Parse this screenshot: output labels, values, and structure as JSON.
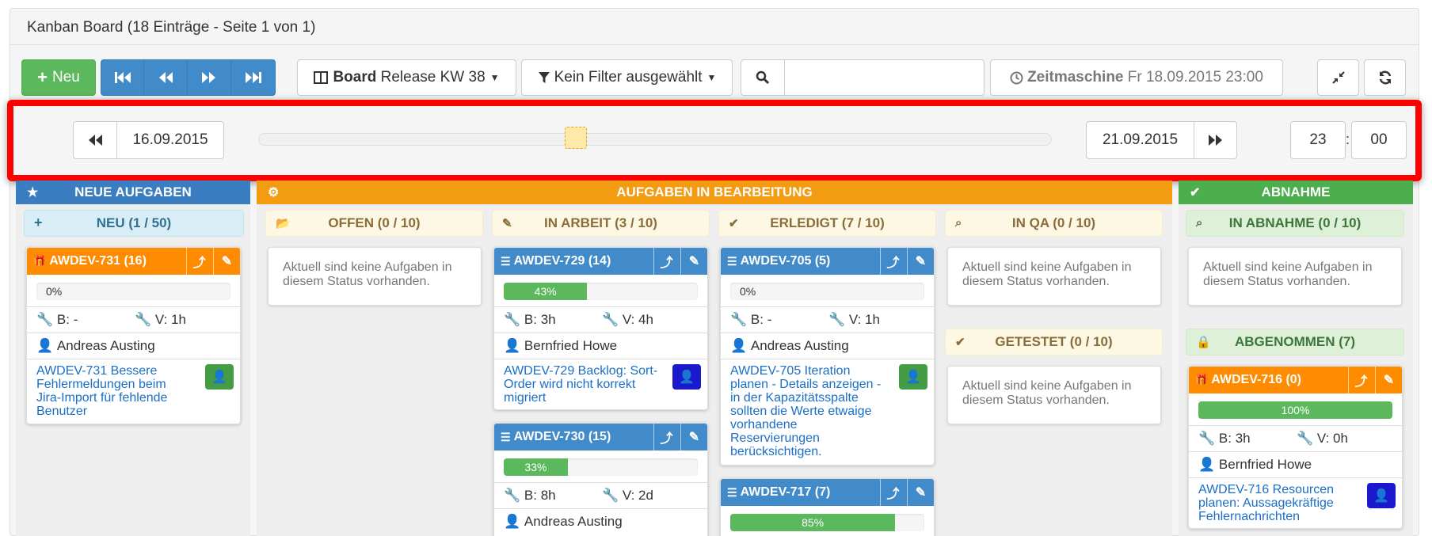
{
  "title": "Kanban Board (18 Einträge - Seite 1 von 1)",
  "toolbar": {
    "new_label": "Neu",
    "board_bold": "Board",
    "board_value": "Release KW 38",
    "filter_label": "Kein Filter ausgewählt",
    "search_value": "",
    "timemachine_bold": "Zeitmaschine",
    "timemachine_value": "Fr 18.09.2015 23:00"
  },
  "timeline": {
    "start_date": "16.09.2015",
    "end_date": "21.09.2015",
    "hour": "23",
    "minute": "00",
    "separator": ":",
    "slider_position": 0.4
  },
  "columns": {
    "neue": {
      "label": "NEUE AUFGABEN",
      "color": "#3a7dc1"
    },
    "bearbeitung": {
      "label": "AUFGABEN IN BEARBEITUNG",
      "color": "#f39c12"
    },
    "abnahme": {
      "label": "ABNAHME",
      "color": "#4cae4c"
    }
  },
  "sublanes": {
    "neu": "NEU (1 / 50)",
    "offen": "OFFEN (0 / 10)",
    "inarbeit": "IN ARBEIT (3 / 10)",
    "erledigt": "ERLEDIGT (7 / 10)",
    "inqa": "IN QA (0 / 10)",
    "getestet": "GETESTET (0 / 10)",
    "inabnahme": "IN ABNAHME (0 / 10)",
    "abgenommen": "ABGENOMMEN (7)"
  },
  "empty_text": "Aktuell sind keine Aufgaben in diesem Status vorhanden.",
  "cards": {
    "c731": {
      "id": "AWDEV-731 (16)",
      "progress_label": "0%",
      "progress": 0,
      "b": "B: -",
      "v": "V: 1h",
      "person": "Andreas Austing",
      "desc": "AWDEV-731 Bessere Fehlermeldungen beim Jira-Import für fehlende Benutzer"
    },
    "c729": {
      "id": "AWDEV-729 (14)",
      "progress_label": "43%",
      "progress": 43,
      "b": "B: 3h",
      "v": "V: 4h",
      "person": "Bernfried Howe",
      "desc": "AWDEV-729 Backlog: Sort-Order wird nicht korrekt migriert"
    },
    "c730": {
      "id": "AWDEV-730 (15)",
      "progress_label": "33%",
      "progress": 33,
      "b": "B: 8h",
      "v": "V: 2d",
      "person": "Andreas Austing"
    },
    "c705": {
      "id": "AWDEV-705 (5)",
      "progress_label": "0%",
      "progress": 0,
      "b": "B: -",
      "v": "V: 1h",
      "person": "Andreas Austing",
      "desc": "AWDEV-705 Iteration planen - Details anzeigen - in der Kapazitätsspalte sollten die Werte etwaige vorhandene Reservierungen berücksichtigen."
    },
    "c717": {
      "id": "AWDEV-717 (7)",
      "progress_label": "85%",
      "progress": 85
    },
    "c716": {
      "id": "AWDEV-716 (0)",
      "progress_label": "100%",
      "progress": 100,
      "b": "B: 3h",
      "v": "V: 0h",
      "person": "Bernfried Howe",
      "desc": "AWDEV-716 Resourcen planen: Aussagekräftige Fehlernachrichten"
    }
  }
}
